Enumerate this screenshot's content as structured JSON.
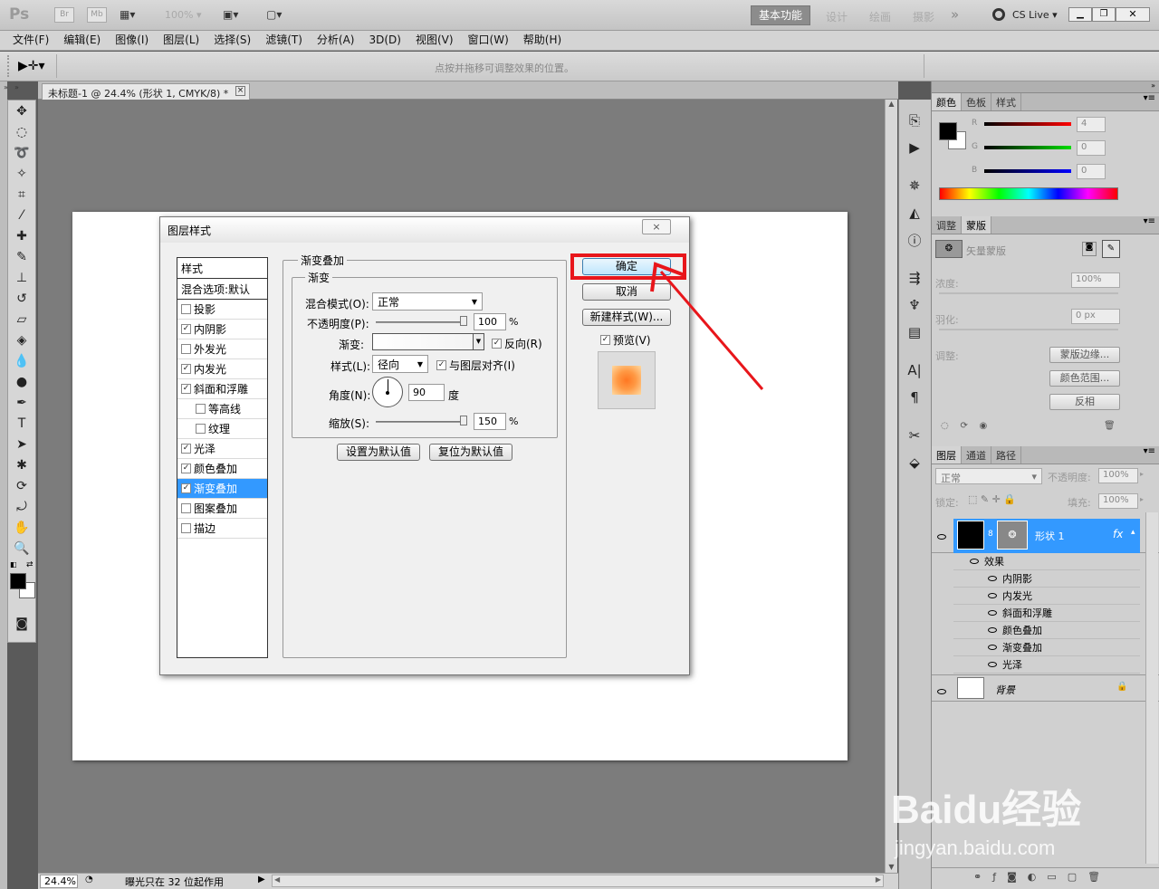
{
  "app": {
    "logo": "Ps",
    "bridge": "Br",
    "minibridge": "Mb",
    "zoom": "100%",
    "workspaces": [
      "基本功能",
      "设计",
      "绘画",
      "摄影"
    ],
    "more": "»",
    "cslive": "CS Live"
  },
  "menu": [
    "文件(F)",
    "编辑(E)",
    "图像(I)",
    "图层(L)",
    "选择(S)",
    "滤镜(T)",
    "分析(A)",
    "3D(D)",
    "视图(V)",
    "窗口(W)",
    "帮助(H)"
  ],
  "options": {
    "hint": "点按并拖移可调整效果的位置。"
  },
  "document": {
    "tab_title": "未标题-1 @ 24.4% (形状 1, CMYK/8) *",
    "close": "×"
  },
  "status": {
    "zoom": "24.4%",
    "text": "曝光只在 32 位起作用"
  },
  "dialog": {
    "title": "图层样式",
    "close": "×",
    "styles_header": "样式",
    "blend_options": "混合选项:默认",
    "styles": [
      {
        "label": "投影",
        "checked": false,
        "indent": false
      },
      {
        "label": "内阴影",
        "checked": true,
        "indent": false
      },
      {
        "label": "外发光",
        "checked": false,
        "indent": false
      },
      {
        "label": "内发光",
        "checked": true,
        "indent": false
      },
      {
        "label": "斜面和浮雕",
        "checked": true,
        "indent": false
      },
      {
        "label": "等高线",
        "checked": false,
        "indent": true
      },
      {
        "label": "纹理",
        "checked": false,
        "indent": true
      },
      {
        "label": "光泽",
        "checked": true,
        "indent": false
      },
      {
        "label": "颜色叠加",
        "checked": true,
        "indent": false
      },
      {
        "label": "渐变叠加",
        "checked": true,
        "indent": false,
        "selected": true
      },
      {
        "label": "图案叠加",
        "checked": false,
        "indent": false
      },
      {
        "label": "描边",
        "checked": false,
        "indent": false
      }
    ],
    "section_title": "渐变叠加",
    "sub_title": "渐变",
    "blend_mode_label": "混合模式(O):",
    "blend_mode_value": "正常",
    "opacity_label": "不透明度(P):",
    "opacity_value": "100",
    "opacity_unit": "%",
    "gradient_label": "渐变:",
    "reverse_label": "反向(R)",
    "reverse_checked": true,
    "style_label": "样式(L):",
    "style_value": "径向",
    "align_label": "与图层对齐(I)",
    "align_checked": true,
    "angle_label": "角度(N):",
    "angle_value": "90",
    "angle_unit": "度",
    "scale_label": "缩放(S):",
    "scale_value": "150",
    "scale_unit": "%",
    "set_default": "设置为默认值",
    "reset_default": "复位为默认值",
    "ok": "确定",
    "cancel": "取消",
    "new_style": "新建样式(W)...",
    "preview_label": "预览(V)",
    "preview_checked": true
  },
  "color_panel": {
    "tabs": [
      "颜色",
      "色板",
      "样式"
    ],
    "r_label": "R",
    "r_value": "4",
    "g_label": "G",
    "g_value": "0",
    "b_label": "B",
    "b_value": "0"
  },
  "mask_panel": {
    "tabs": [
      "调整",
      "蒙版"
    ],
    "vector_mask": "矢量蒙版",
    "density_label": "浓度:",
    "density_value": "100%",
    "feather_label": "羽化:",
    "feather_value": "0 px",
    "refine_label": "调整:",
    "mask_edge": "蒙版边缘...",
    "color_range": "颜色范围...",
    "invert": "反相"
  },
  "layers_panel": {
    "tabs": [
      "图层",
      "通道",
      "路径"
    ],
    "blend_mode": "正常",
    "opacity_label": "不透明度:",
    "opacity_value": "100%",
    "lock_label": "锁定:",
    "fill_label": "填充:",
    "fill_value": "100%",
    "layer_name": "形状 1",
    "fx": "fx",
    "effects_label": "效果",
    "effects": [
      "内阴影",
      "内发光",
      "斜面和浮雕",
      "颜色叠加",
      "渐变叠加",
      "光泽"
    ],
    "background": "背景"
  },
  "watermark": {
    "brand": "Baidu经验",
    "url": "jingyan.baidu.com"
  },
  "colors": {
    "accent": "#3399ff",
    "annotation": "#e8161b",
    "ui_bg": "#d4d4d4"
  }
}
